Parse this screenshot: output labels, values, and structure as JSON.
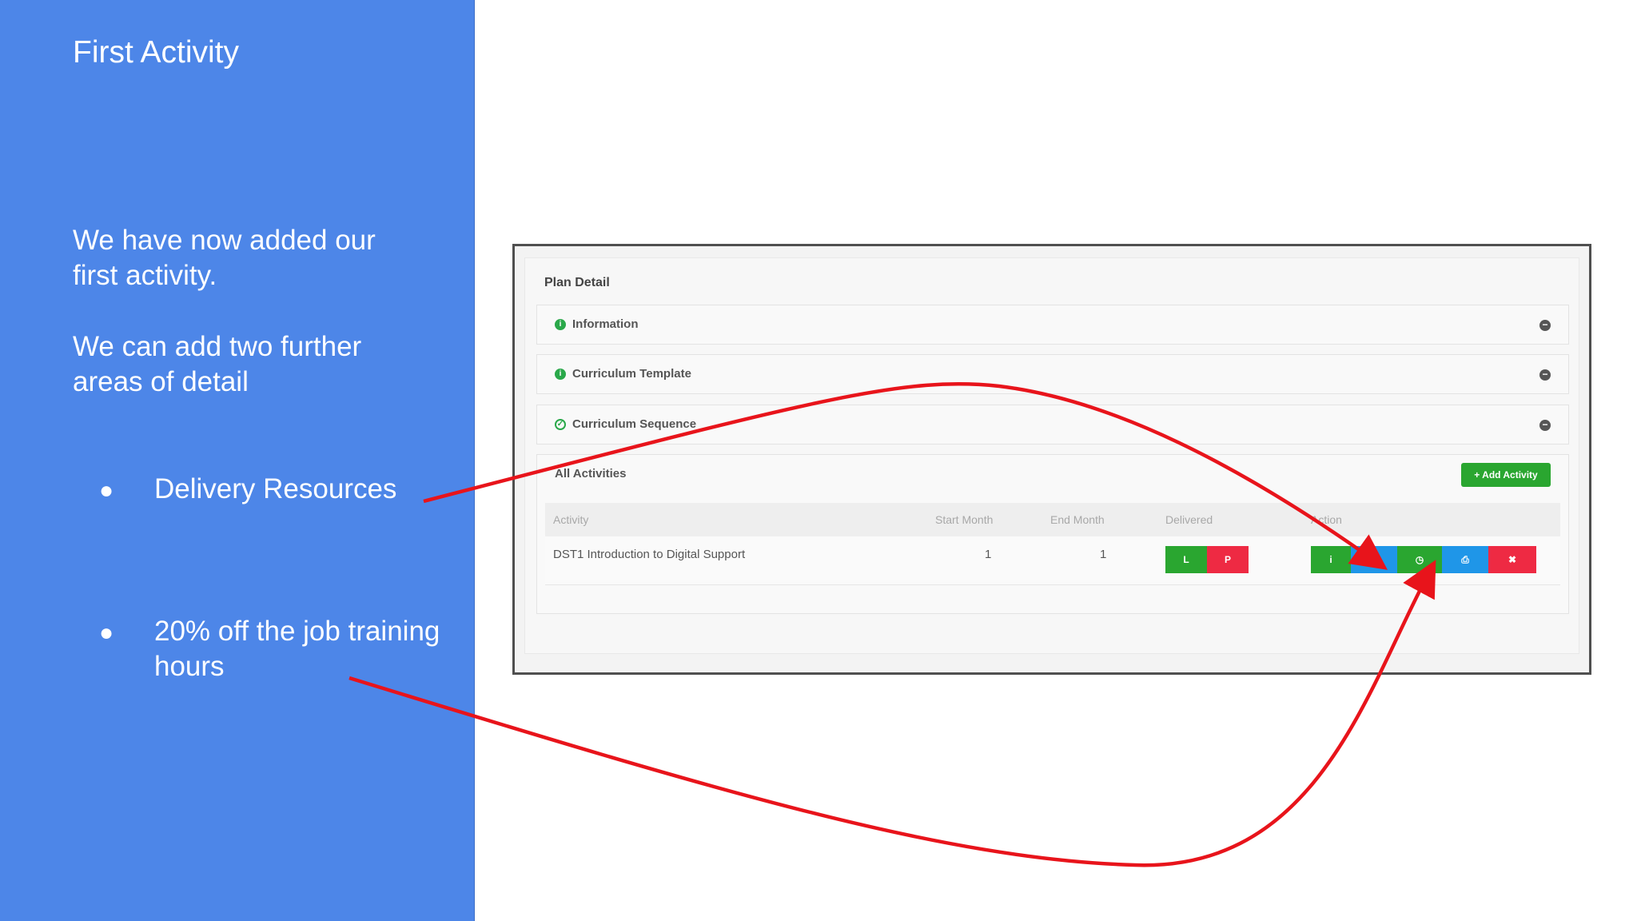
{
  "slide": {
    "title": "First Activity",
    "paragraph1": "We have now added our first activity.",
    "paragraph2": "We can add two further areas of detail",
    "bullets": [
      "Delivery Resources",
      "20% off the job training hours"
    ],
    "bullet_glyph": "●"
  },
  "screenshot": {
    "panel_title": "Plan Detail",
    "sections": [
      {
        "label": "Information",
        "icon": "info-circle-icon"
      },
      {
        "label": "Curriculum Template",
        "icon": "info-circle-icon"
      },
      {
        "label": "Curriculum Sequence",
        "icon": "check-circle-icon"
      }
    ],
    "activities": {
      "title": "All Activities",
      "add_button": "+ Add Activity",
      "columns": [
        "Activity",
        "Start Month",
        "End Month",
        "Delivered",
        "Action"
      ],
      "rows": [
        {
          "activity": "DST1 Introduction to Digital Support",
          "start_month": "1",
          "end_month": "1"
        }
      ],
      "delivered_buttons": [
        "L",
        "P"
      ],
      "action_icons": [
        "info-icon",
        "book-icon",
        "clock-icon",
        "print-icon",
        "delete-icon"
      ],
      "action_glyphs": [
        "i",
        "■",
        "◷",
        "⎙",
        "✖"
      ]
    }
  },
  "colors": {
    "panel_blue": "#4d86e8",
    "arrow_red": "#e8141b",
    "button_green": "#2aa630",
    "button_red": "#ee2a43",
    "button_blue": "#1f96e8"
  }
}
